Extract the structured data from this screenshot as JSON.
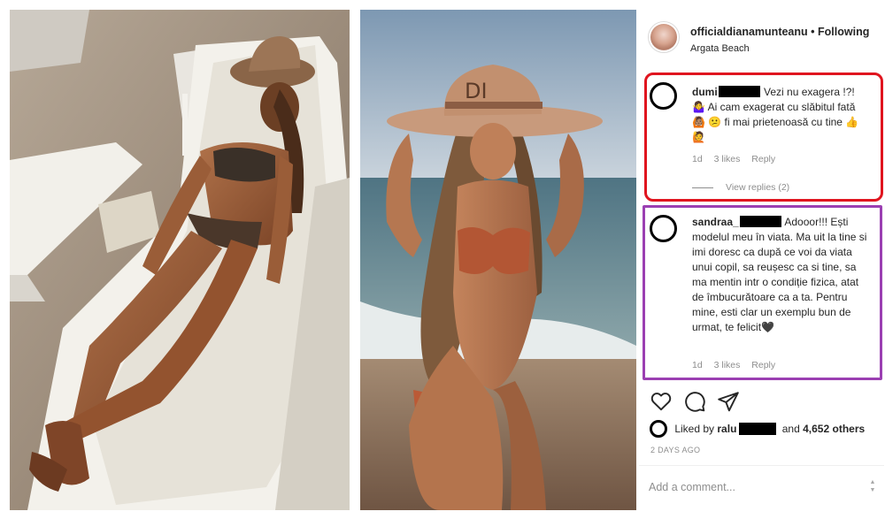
{
  "post": {
    "username": "officialdianamunteanu",
    "separator": "•",
    "follow_label": "Following",
    "location": "Argata Beach"
  },
  "comments": [
    {
      "username": "dumi",
      "text": "Vezi nu exagera !?! 🤷‍♀️ Ai cam exagerat cu slăbitul fată 🙆🏽 😕 fi mai prietenoasă cu tine 👍🙋",
      "age": "1d",
      "likes": "3 likes",
      "reply_label": "Reply",
      "view_replies": "View replies (2)"
    },
    {
      "username": "sandraa_",
      "text": "Adooor!!! Ești modelul meu în viata. Ma uit la tine si imi doresc ca după ce voi da viata unui copil, sa reușesc ca si tine, sa ma mentin intr o condiție fizica, atat de îmbucurătoare ca a ta. Pentru mine, esti clar un exemplu bun de urmat, te felicit🖤",
      "age": "1d",
      "likes": "3 likes",
      "reply_label": "Reply"
    }
  ],
  "actions": {
    "icons": [
      "heart-icon",
      "comment-icon",
      "share-icon"
    ]
  },
  "likes": {
    "prefix": "Liked by",
    "user": "ralu",
    "joiner": "and",
    "others": "4,652 others"
  },
  "date": "2 DAYS AGO",
  "add_comment": {
    "placeholder": "Add a comment..."
  },
  "colors": {
    "highlight_red": "#e0151f",
    "highlight_purple": "#9b3fb2",
    "text": "#262626",
    "muted": "#8e8e8e"
  }
}
